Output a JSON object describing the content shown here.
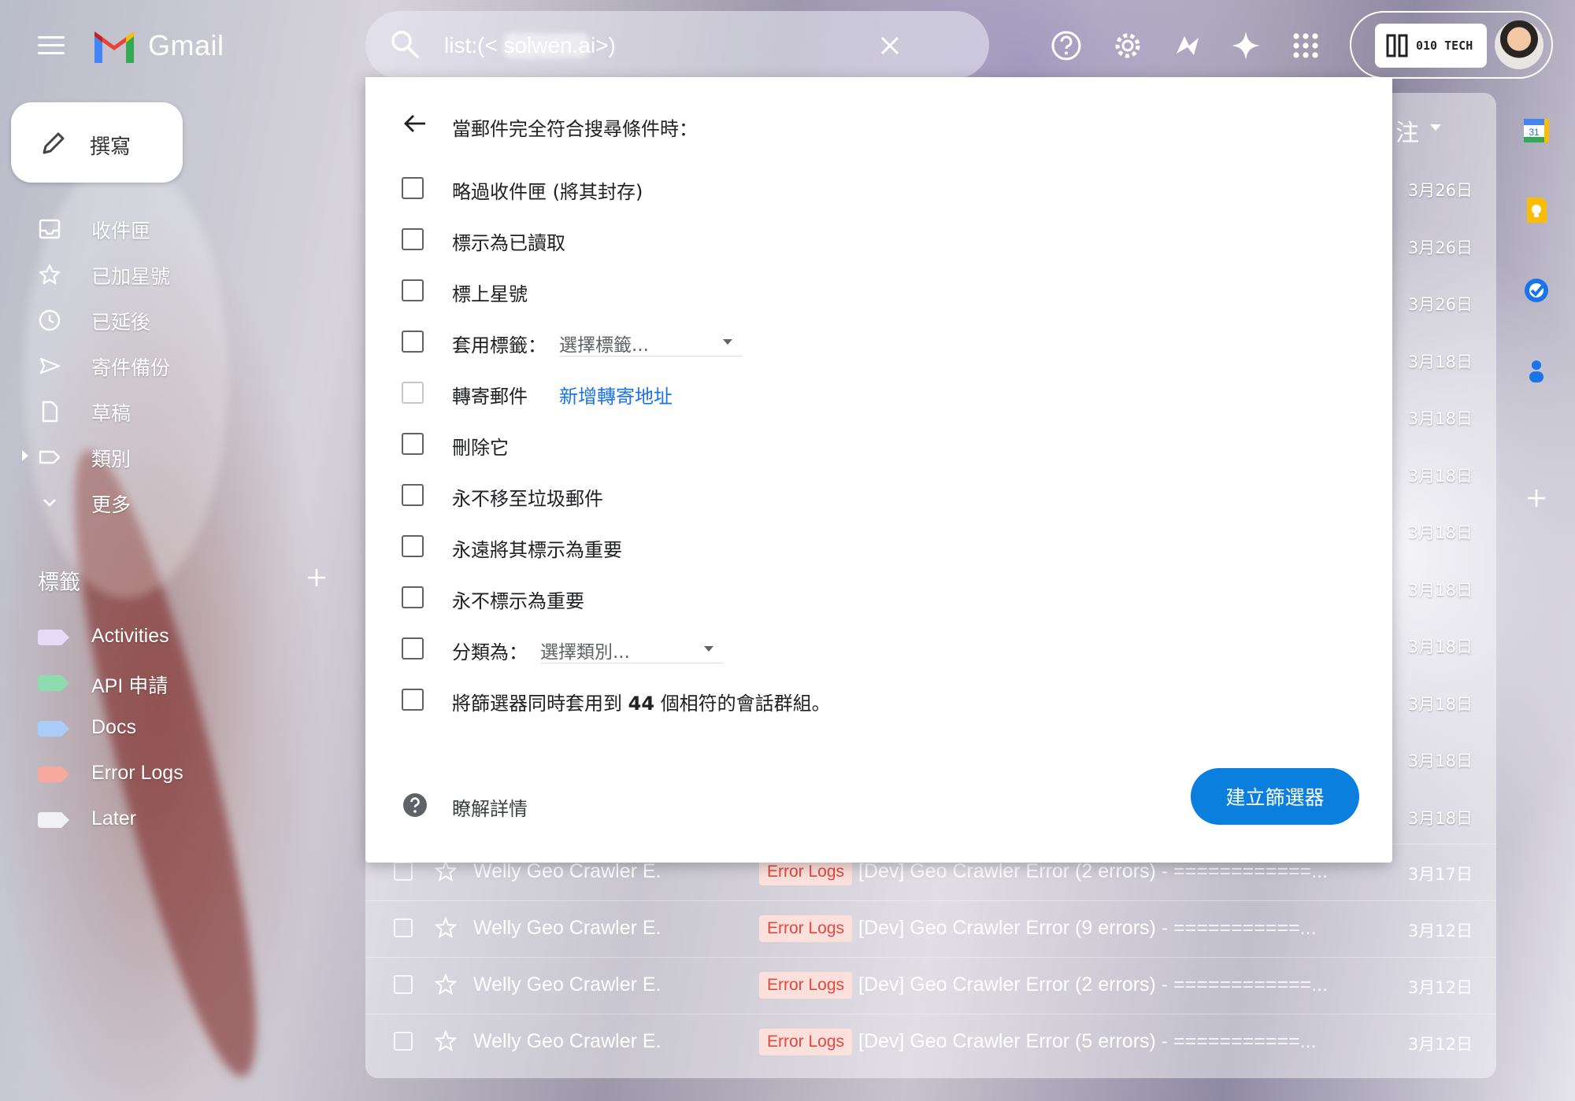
{
  "app": {
    "name": "Gmail"
  },
  "search": {
    "query": "list:(< solwen.ai>)"
  },
  "account": {
    "brand": "010 TECH"
  },
  "compose": {
    "label": "撰寫"
  },
  "nav": [
    {
      "label": "收件匣",
      "icon": "inbox-icon"
    },
    {
      "label": "已加星號",
      "icon": "star-icon"
    },
    {
      "label": "已延後",
      "icon": "clock-icon"
    },
    {
      "label": "寄件備份",
      "icon": "send-icon"
    },
    {
      "label": "草稿",
      "icon": "draft-icon"
    },
    {
      "label": "類別",
      "icon": "label-outline-icon"
    },
    {
      "label": "更多",
      "icon": "chevron-down-icon"
    }
  ],
  "labels": {
    "heading": "標籤",
    "items": [
      {
        "label": "Activities",
        "color": "#e6dbf7"
      },
      {
        "label": "API 申請",
        "color": "#8edbb0"
      },
      {
        "label": "Docs",
        "color": "#a9cdf7"
      },
      {
        "label": "Error Logs",
        "color": "#f6a99c"
      },
      {
        "label": "Later",
        "color": "#f1f1f1"
      }
    ]
  },
  "list": {
    "sort_label": "注",
    "dates_behind_dialog": [
      "3月26日",
      "3月26日",
      "3月26日",
      "3月18日",
      "3月18日",
      "3月18日",
      "3月18日",
      "3月18日",
      "3月18日",
      "3月18日",
      "3月18日",
      "3月18日"
    ],
    "rows": [
      {
        "sender": "Welly Geo Crawler E.",
        "label": "Error Logs",
        "subject": "[Dev] Geo Crawler Error (2 errors)",
        "snippet": " - ============...",
        "date": "3月17日"
      },
      {
        "sender": "Welly Geo Crawler E.",
        "label": "Error Logs",
        "subject": "[Dev] Geo Crawler Error (9 errors)",
        "snippet": " - ===========...",
        "date": "3月12日"
      },
      {
        "sender": "Welly Geo Crawler E.",
        "label": "Error Logs",
        "subject": "[Dev] Geo Crawler Error (2 errors)",
        "snippet": " - ============...",
        "date": "3月12日"
      },
      {
        "sender": "Welly Geo Crawler E.",
        "label": "Error Logs",
        "subject": "[Dev] Geo Crawler Error (5 errors)",
        "snippet": " - ===========...",
        "date": "3月12日"
      }
    ]
  },
  "filter": {
    "title": "當郵件完全符合搜尋條件時：",
    "options": {
      "skip_inbox": "略過收件匣 (將其封存)",
      "mark_read": "標示為已讀取",
      "star": "標上星號",
      "apply_label": "套用標籤：",
      "label_placeholder": "選擇標籤...",
      "forward": "轉寄郵件",
      "add_forward": "新增轉寄地址",
      "delete": "刪除它",
      "never_spam": "永不移至垃圾郵件",
      "always_important": "永遠將其標示為重要",
      "never_important": "永不標示為重要",
      "categorize": "分類為：",
      "category_placeholder": "選擇類別...",
      "apply_prefix": "將篩選器同時套用到",
      "match_count": "44",
      "apply_suffix": "個相符的會話群組。"
    },
    "learn_more": "瞭解詳情",
    "create_button": "建立篩選器"
  },
  "colors": {
    "accent": "#0b7fde",
    "link": "#1a73e8",
    "chip_text": "#e2483d"
  }
}
